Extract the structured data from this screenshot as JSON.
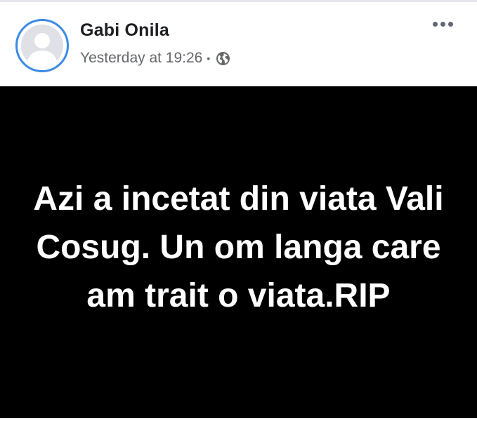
{
  "post": {
    "author_name": "Gabi Onila",
    "timestamp": "Yesterday at 19:26",
    "separator": "•",
    "privacy_icon": "globe-icon",
    "more_icon": "more-options-icon",
    "image_text": "Azi a incetat din viata Vali Cosug. Un om langa care am trait o viata.RIP"
  },
  "colors": {
    "avatar_ring": "#3b8ae6",
    "image_background": "#000000",
    "image_text": "#ffffff",
    "meta_text": "#65676b"
  }
}
